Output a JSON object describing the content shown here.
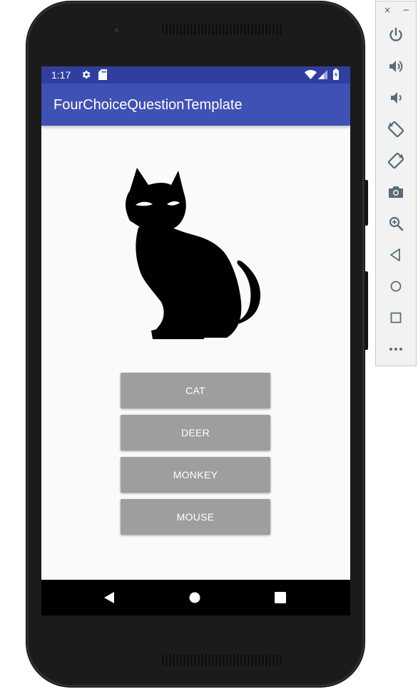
{
  "status_bar": {
    "time": "1:17",
    "icons": [
      "settings-icon",
      "sd-card-icon",
      "wifi-icon",
      "cell-signal-icon",
      "battery-icon"
    ]
  },
  "app_bar": {
    "title": "FourChoiceQuestionTemplate",
    "color": "#3f51b5",
    "status_color": "#303f9f"
  },
  "question": {
    "image_icon": "cat-silhouette"
  },
  "choices": [
    {
      "label": "CAT"
    },
    {
      "label": "DEER"
    },
    {
      "label": "MONKEY"
    },
    {
      "label": "MOUSE"
    }
  ],
  "nav_bar": {
    "buttons": [
      "back-icon",
      "home-icon",
      "recents-icon"
    ]
  },
  "emulator_toolbar": {
    "window_controls": {
      "close": "×",
      "minimize": "−"
    },
    "tools": [
      "power-icon",
      "volume-up-icon",
      "volume-down-icon",
      "rotate-left-icon",
      "rotate-right-icon",
      "screenshot-icon",
      "zoom-icon",
      "back-icon",
      "home-icon",
      "overview-icon",
      "more-icon"
    ],
    "accent": "#546e7a"
  },
  "colors": {
    "button": "#9e9e9e",
    "button_text": "#ffffff",
    "background": "#fafafa"
  }
}
